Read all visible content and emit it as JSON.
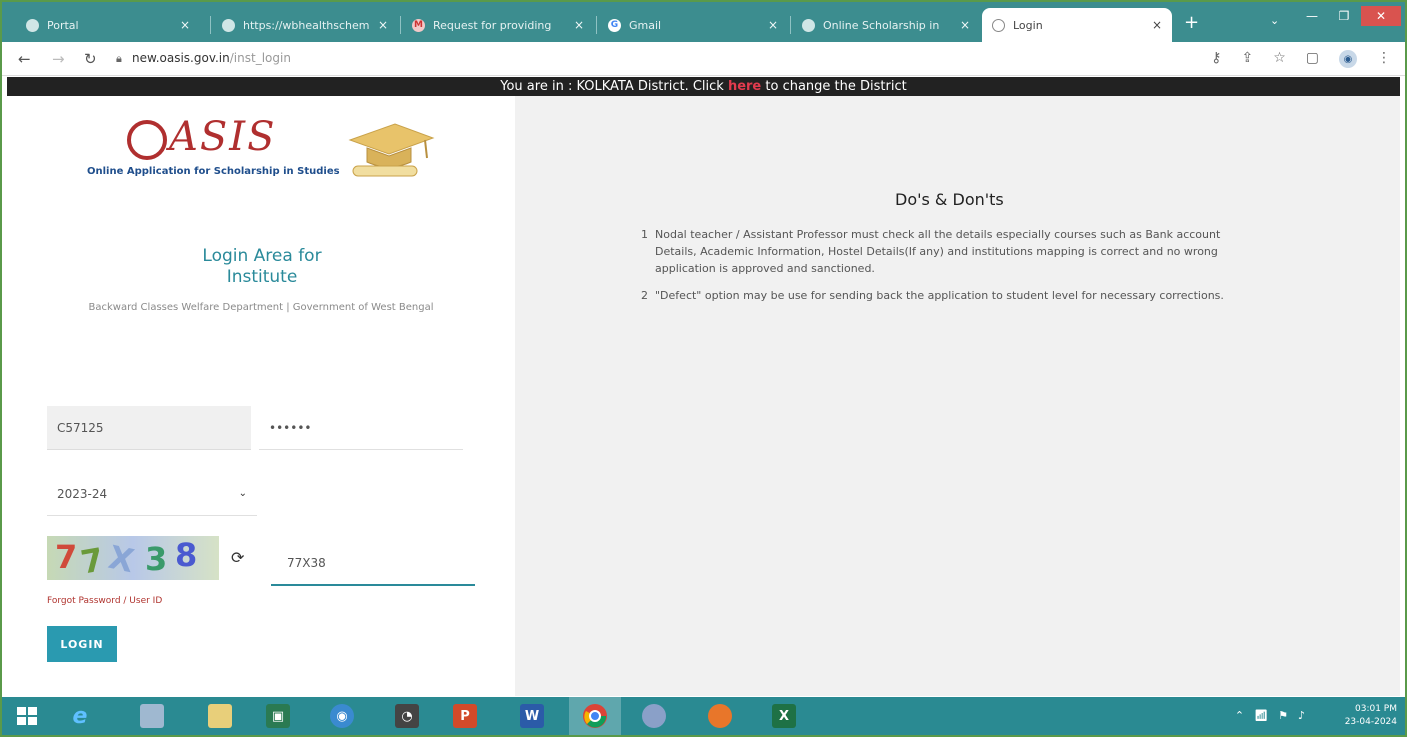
{
  "browser": {
    "tabs": [
      {
        "label": "Portal",
        "icon": "globe-icon",
        "close": "×"
      },
      {
        "label": "https://wbhealthschem",
        "icon": "globe-icon",
        "close": "×"
      },
      {
        "label": "Request for providing",
        "icon": "mail-icon",
        "close": "×"
      },
      {
        "label": "Gmail",
        "icon": "google-icon",
        "close": "×"
      },
      {
        "label": "Online Scholarship in",
        "icon": "globe-icon",
        "close": "×"
      },
      {
        "label": "Login",
        "icon": "globe-icon",
        "close": "×",
        "active": true
      }
    ],
    "new_tab": "+",
    "url_host": "new.oasis.gov.in",
    "url_path": "/inst_login"
  },
  "district_bar": {
    "prefix": "You are in : KOLKATA District. Click ",
    "link": "here",
    "suffix": " to change the District"
  },
  "logo": {
    "word": "ASIS",
    "subtitle": "Online Application for Scholarship in Studies"
  },
  "login": {
    "title_line1": "Login Area for",
    "title_line2": "Institute",
    "department": "Backward Classes Welfare Department | Government of West Bengal",
    "user_id": "C57125",
    "password_mask": "••••••",
    "year": "2023-24",
    "captcha_chars": [
      "7",
      "7",
      "X",
      "3",
      "8"
    ],
    "captcha_input": "77X38",
    "forgot": "Forgot Password / User ID",
    "button": "LOGIN"
  },
  "dos_donts": {
    "title": "Do's & Don'ts",
    "items": [
      {
        "num": "1",
        "text": "Nodal teacher / Assistant Professor must check all the details especially courses such as Bank account Details, Academic Information, Hostel Details(If any) and institutions mapping is correct and no wrong application is approved and sanctioned."
      },
      {
        "num": "2",
        "text": "\"Defect\" option may be use for sending back the application to student level for necessary corrections."
      }
    ]
  },
  "taskbar": {
    "time": "03:01 PM",
    "date": "23-04-2024"
  },
  "colors": {
    "tabstrip": "#3c8d8f",
    "accent": "#2a8a9a",
    "district_bar": "#222222",
    "here_link": "#e23b4e",
    "logo_red": "#b02f2f",
    "logo_blue": "#1f4e8c"
  }
}
